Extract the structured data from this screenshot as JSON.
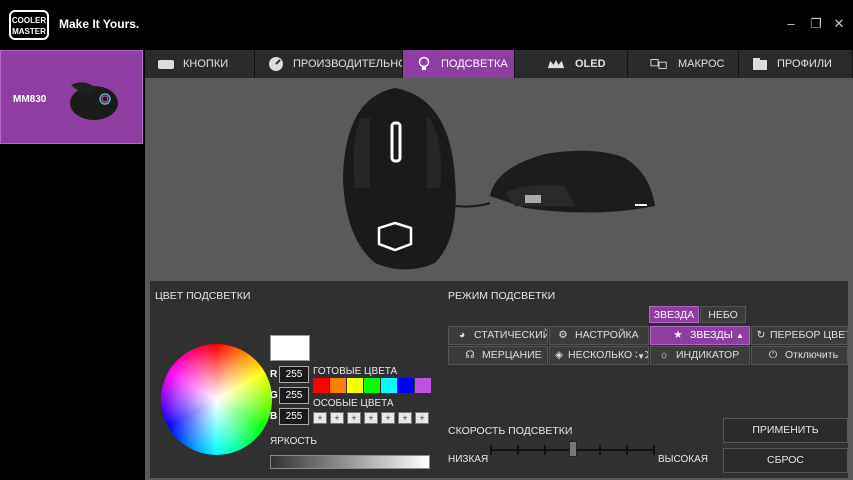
{
  "app": {
    "logo_text": "COOLER MASTER",
    "tagline": "Make It Yours."
  },
  "window_controls": {
    "minimize": "–",
    "maximize": "❐",
    "close": "✕"
  },
  "sidebar": {
    "device_name": "MM830"
  },
  "tabs": [
    {
      "label": "КНОПКИ",
      "icon": "keyboard-icon",
      "active": false
    },
    {
      "label": "ПРОИЗВОДИТЕЛЬНОСТЬ",
      "icon": "gauge-icon",
      "active": false
    },
    {
      "label": "ПОДСВЕТКА",
      "icon": "bulb-icon",
      "active": true
    },
    {
      "label": "OLED",
      "icon": "crown-icon",
      "active": false
    },
    {
      "label": "МАКРОС",
      "icon": "macro-icon",
      "active": false
    },
    {
      "label": "ПРОФИЛИ",
      "icon": "folder-icon",
      "active": false
    }
  ],
  "lighting_color": {
    "title": "ЦВЕТ ПОДСВЕТКИ",
    "r_label": "R",
    "r_value": "255",
    "g_label": "G",
    "g_value": "255",
    "b_label": "B",
    "b_value": "255",
    "presets_label": "ГОТОВЫЕ ЦВЕТА",
    "preset_colors": [
      "#ff0000",
      "#ff8000",
      "#ffff00",
      "#00ff00",
      "#00ffff",
      "#0000ff",
      "#c050e0"
    ],
    "custom_label": "ОСОБЫЕ ЦВЕТА",
    "custom_slot": "+",
    "brightness_label": "ЯРКОСТЬ",
    "selected_color": "#ffffff"
  },
  "lighting_mode": {
    "title": "РЕЖИМ ПОДСВЕТКИ",
    "sub_tabs": [
      {
        "label": "ЗВЕЗДА",
        "active": true
      },
      {
        "label": "НЕБО",
        "active": false
      }
    ],
    "buttons_row1": [
      {
        "label": "СТАТИЧЕСКИЙ",
        "icon": "palette-icon"
      },
      {
        "label": "НАСТРОЙКА",
        "icon": "gear-icon"
      },
      {
        "label": "ЗВЕЗДЫ",
        "icon": "star-icon",
        "arrow": "▲",
        "active": true
      },
      {
        "label": "ПЕРЕБОР ЦВЕТО",
        "icon": "cycle-icon"
      }
    ],
    "buttons_row2": [
      {
        "label": "МЕРЦАНИЕ",
        "icon": "pulse-icon"
      },
      {
        "label": "НЕСКОЛЬКО ЗОН",
        "icon": "layers-icon",
        "arrow": "▼"
      },
      {
        "label": "ИНДИКАТОР",
        "icon": "indicator-icon"
      },
      {
        "label": "Отключить",
        "icon": "power-icon"
      }
    ]
  },
  "speed": {
    "title": "СКОРОСТЬ ПОДСВЕТКИ",
    "low_label": "НИЗКАЯ",
    "high_label": "ВЫСОКАЯ",
    "level": 0.5
  },
  "actions": {
    "apply": "ПРИМЕНИТЬ",
    "reset": "СБРОС"
  }
}
